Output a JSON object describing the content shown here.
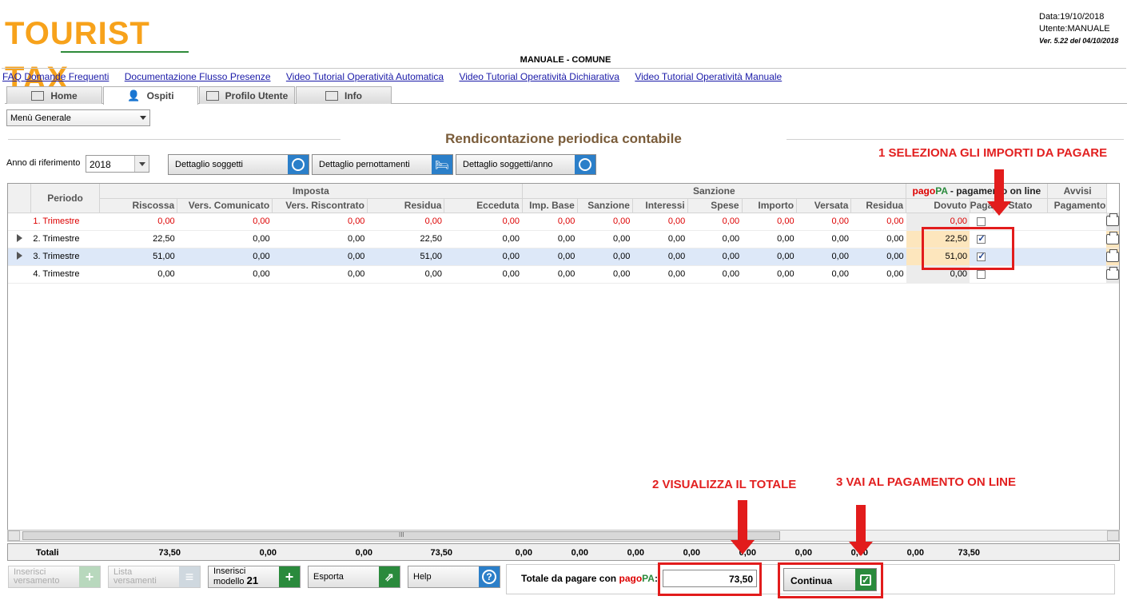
{
  "header": {
    "logo": "TOURIST TAX",
    "date": "Data:19/10/2018",
    "user": "Utente:MANUALE",
    "version": "Ver. 5.22 del 04/10/2018",
    "center_title": "MANUALE - COMUNE"
  },
  "links": [
    "FAQ Domande Frequenti",
    "Documentazione Flusso Presenze",
    "Video Tutorial Operatività Automatica",
    "Video Tutorial Operatività Dichiarativa",
    "Video Tutorial Operatività Manuale"
  ],
  "tabs": [
    "Home",
    "Ospiti",
    "Profilo Utente",
    "Info"
  ],
  "active_tab": "Ospiti",
  "menu_select": "Menù Generale",
  "section_title": "Rendicontazione periodica contabile",
  "year": {
    "label": "Anno di riferimento",
    "value": "2018"
  },
  "detail_buttons": [
    "Dettaglio soggetti",
    "Dettaglio pernottamenti",
    "Dettaglio soggetti/anno"
  ],
  "annotations": {
    "a1": "1 SELEZIONA GLI IMPORTI DA PAGARE",
    "a2": "2 VISUALIZZA IL TOTALE",
    "a3": "3 VAI AL PAGAMENTO ON LINE"
  },
  "grid": {
    "group_headers": {
      "periodo": "Periodo",
      "imposta": "Imposta",
      "sanzione": "Sanzione",
      "pagopa_pago": "pago",
      "pagopa_pa": "PA",
      "pagopa_rest": " - pagamento on line",
      "avvisi": "Avvisi"
    },
    "columns": [
      "Riscossa",
      "Vers. Comunicato",
      "Vers. Riscontrato",
      "Residua",
      "Ecceduta",
      "Imp. Base",
      "Sanzione",
      "Interessi",
      "Spese",
      "Importo",
      "Versata",
      "Residua",
      "Dovuto",
      "Paga",
      "Stato",
      "Pagamento"
    ],
    "rows": [
      {
        "periodo": "1. Trimestre",
        "vals": [
          "0,00",
          "0,00",
          "0,00",
          "0,00",
          "0,00",
          "0,00",
          "0,00",
          "0,00",
          "0,00",
          "0,00",
          "0,00",
          "0,00"
        ],
        "dovuto": "0,00",
        "paga": false,
        "stato": ""
      },
      {
        "periodo": "2. Trimestre",
        "vals": [
          "22,50",
          "0,00",
          "0,00",
          "22,50",
          "0,00",
          "0,00",
          "0,00",
          "0,00",
          "0,00",
          "0,00",
          "0,00",
          "0,00"
        ],
        "dovuto": "22,50",
        "paga": true,
        "stato": ""
      },
      {
        "periodo": "3. Trimestre",
        "vals": [
          "51,00",
          "0,00",
          "0,00",
          "51,00",
          "0,00",
          "0,00",
          "0,00",
          "0,00",
          "0,00",
          "0,00",
          "0,00",
          "0,00"
        ],
        "dovuto": "51,00",
        "paga": true,
        "stato": ""
      },
      {
        "periodo": "4. Trimestre",
        "vals": [
          "0,00",
          "0,00",
          "0,00",
          "0,00",
          "0,00",
          "0,00",
          "0,00",
          "0,00",
          "0,00",
          "0,00",
          "0,00",
          "0,00"
        ],
        "dovuto": "0,00",
        "paga": false,
        "stato": ""
      }
    ],
    "scroll_mark": "III"
  },
  "totals": {
    "label": "Totali",
    "vals": [
      "73,50",
      "0,00",
      "0,00",
      "73,50",
      "0,00",
      "0,00",
      "0,00",
      "0,00",
      "0,00",
      "0,00",
      "0,00",
      "0,00",
      "73,50"
    ]
  },
  "bottom": {
    "inserisci_versamento": [
      "Inserisci",
      "versamento"
    ],
    "lista_versamenti": [
      "Lista",
      "versamenti"
    ],
    "inserisci_modello": [
      "Inserisci",
      "modello",
      "21"
    ],
    "esporta": "Esporta",
    "help": "Help",
    "pay_label_pre": "Totale da pagare con ",
    "pay_pago": "pago",
    "pay_pa": "PA",
    "pay_colon": ":",
    "pay_total": "73,50",
    "continua": "Continua"
  },
  "colors": {
    "accent_red": "#e21c1c",
    "logo_orange": "#f7a21b",
    "pagopa_green": "#2a8a3c"
  }
}
